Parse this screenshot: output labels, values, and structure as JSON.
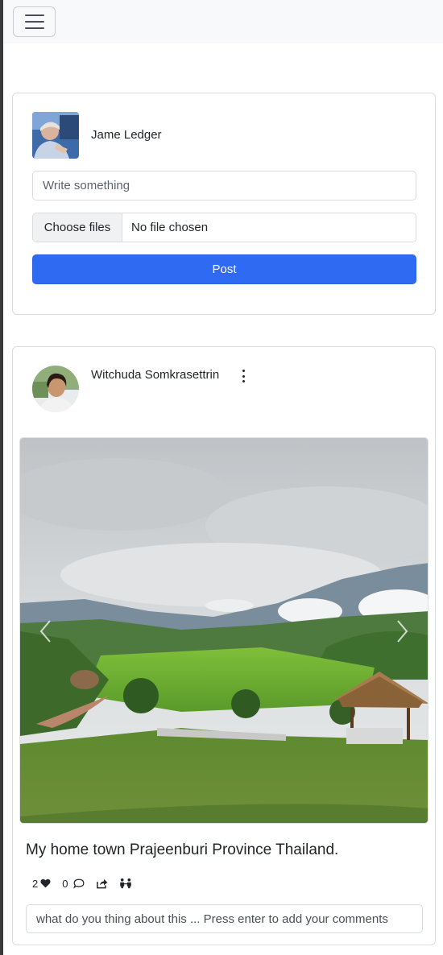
{
  "navbar": {
    "toggler_icon": "hamburger-menu-icon"
  },
  "composer": {
    "user_name": "Jame Ledger",
    "text_placeholder": "Write something",
    "file_button_label": "Choose files",
    "file_status": "No file chosen",
    "post_button_label": "Post",
    "colors": {
      "post_button": "#2f6bf2"
    }
  },
  "post": {
    "author_name": "Witchuda Somkrasettrin",
    "menu_icon": "vertical-ellipsis-icon",
    "image_subject": "valley landscape with cloudy sky, green rice fields and thatched hut",
    "caption": "My home town Prajeenburi Province Thailand.",
    "likes_count": "2",
    "comments_count": "0",
    "comment_placeholder": "what do you thing about this ... Press enter to add your comments",
    "action_icons": [
      "heart-icon",
      "comment-icon",
      "share-icon",
      "people-icon"
    ],
    "carousel_icons": [
      "chevron-left-icon",
      "chevron-right-icon"
    ]
  }
}
